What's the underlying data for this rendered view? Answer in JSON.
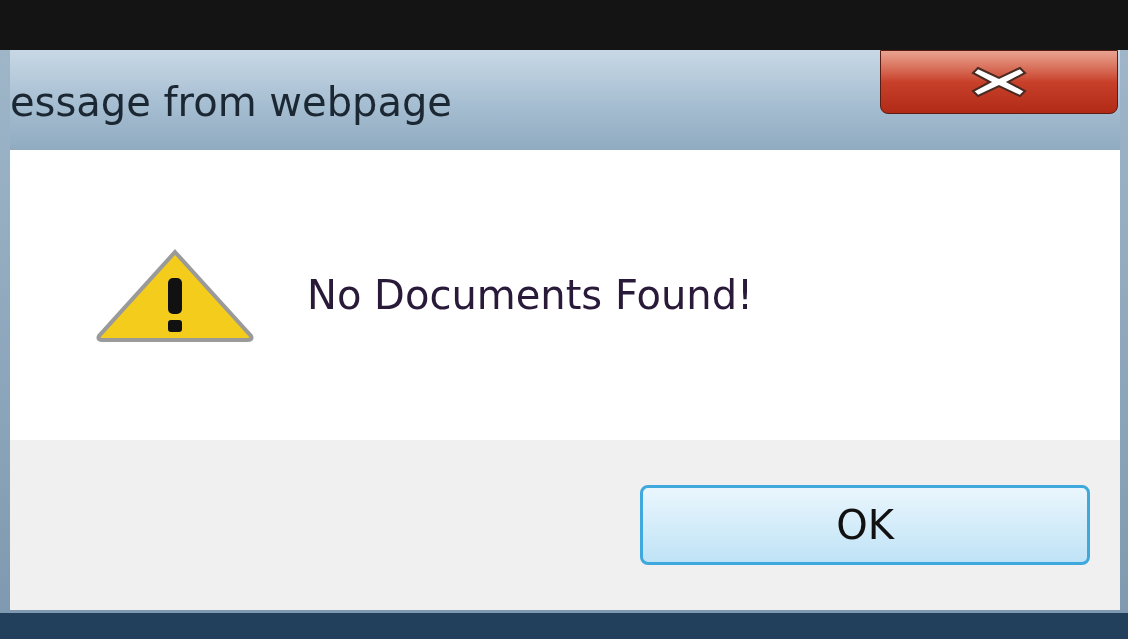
{
  "window": {
    "title": "essage from webpage"
  },
  "message": "No Documents Found!",
  "buttons": [
    {
      "label": "OK",
      "kind": "default"
    }
  ]
}
